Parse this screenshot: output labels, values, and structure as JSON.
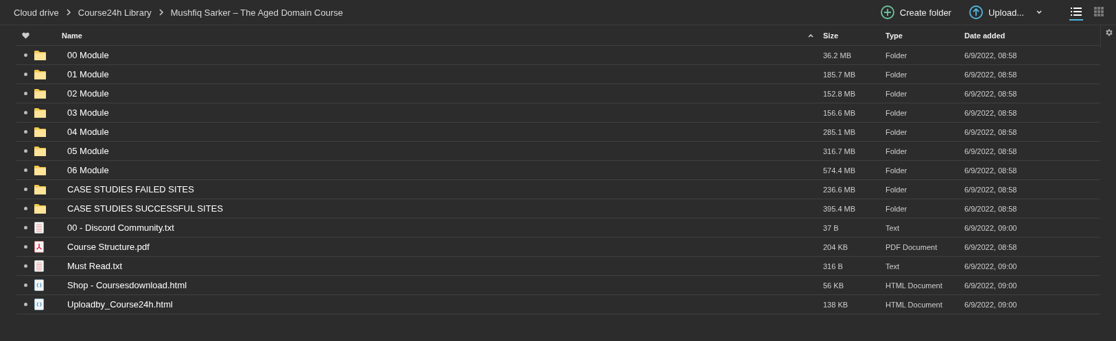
{
  "breadcrumbs": [
    "Cloud drive",
    "Course24h Library",
    "Mushfiq Sarker – The Aged Domain Course"
  ],
  "actions": [
    {
      "kind": "create",
      "label": "Create folder"
    },
    {
      "kind": "upload",
      "label": "Upload..."
    }
  ],
  "view_toggle": [
    {
      "kind": "list",
      "selected": true
    },
    {
      "kind": "grid",
      "selected": false
    }
  ],
  "table": {
    "columns": [
      {
        "label": "Name",
        "sorted": true
      },
      {
        "label": "Size",
        "sorted": false
      },
      {
        "label": "Type",
        "sorted": false
      },
      {
        "label": "Date added",
        "sorted": false
      }
    ],
    "rows": [
      {
        "kind": "folder",
        "name": "00 Module",
        "size": "36.2 MB",
        "type": "Folder",
        "date": "6/9/2022, 08:58"
      },
      {
        "kind": "folder",
        "name": "01 Module",
        "size": "185.7 MB",
        "type": "Folder",
        "date": "6/9/2022, 08:58"
      },
      {
        "kind": "folder",
        "name": "02 Module",
        "size": "152.8 MB",
        "type": "Folder",
        "date": "6/9/2022, 08:58"
      },
      {
        "kind": "folder",
        "name": "03 Module",
        "size": "156.6 MB",
        "type": "Folder",
        "date": "6/9/2022, 08:58"
      },
      {
        "kind": "folder",
        "name": "04 Module",
        "size": "285.1 MB",
        "type": "Folder",
        "date": "6/9/2022, 08:58"
      },
      {
        "kind": "folder",
        "name": "05 Module",
        "size": "316.7 MB",
        "type": "Folder",
        "date": "6/9/2022, 08:58"
      },
      {
        "kind": "folder",
        "name": "06 Module",
        "size": "574.4 MB",
        "type": "Folder",
        "date": "6/9/2022, 08:58"
      },
      {
        "kind": "folder",
        "name": "CASE STUDIES FAILED SITES",
        "size": "236.6 MB",
        "type": "Folder",
        "date": "6/9/2022, 08:58"
      },
      {
        "kind": "folder",
        "name": "CASE STUDIES SUCCESSFUL SITES",
        "size": "395.4 MB",
        "type": "Folder",
        "date": "6/9/2022, 08:58"
      },
      {
        "kind": "text",
        "name": "00 - Discord Community.txt",
        "size": "37 B",
        "type": "Text",
        "date": "6/9/2022, 09:00"
      },
      {
        "kind": "pdf",
        "name": "Course Structure.pdf",
        "size": "204 KB",
        "type": "PDF Document",
        "date": "6/9/2022, 08:58"
      },
      {
        "kind": "text",
        "name": "Must Read.txt",
        "size": "316 B",
        "type": "Text",
        "date": "6/9/2022, 09:00"
      },
      {
        "kind": "html",
        "name": "Shop - Coursesdownload.html",
        "size": "56 KB",
        "type": "HTML Document",
        "date": "6/9/2022, 09:00"
      },
      {
        "kind": "html",
        "name": "Uploadby_Course24h.html",
        "size": "138 KB",
        "type": "HTML Document",
        "date": "6/9/2022, 09:00"
      }
    ]
  }
}
